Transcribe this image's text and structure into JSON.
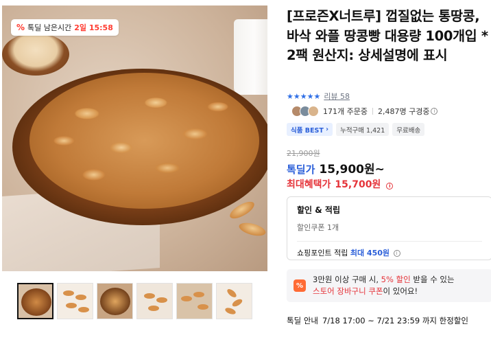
{
  "product_image": {
    "timer": {
      "label": "톡딜 남은시간",
      "value": "2일 15:58"
    }
  },
  "thumbnails": [
    {
      "name": "thumb-1"
    },
    {
      "name": "thumb-2"
    },
    {
      "name": "thumb-3"
    },
    {
      "name": "thumb-4"
    },
    {
      "name": "thumb-5"
    },
    {
      "name": "thumb-6"
    }
  ],
  "product": {
    "title": "[프로즌X너트루] 껍질없는 통땅콩, 바삭 와플 땅콩빵 대용량 100개입 * 2팩 원산지: 상세설명에 표시",
    "rating": {
      "stars": "★★★★★",
      "stars_value": 5,
      "review_label": "리뷰 58"
    },
    "social": {
      "orders": "171개 주문중",
      "subscribers": "2,487명 구경중"
    },
    "badges": {
      "best": "식품 BEST",
      "cumulative": "누적구매 1,421",
      "shipping": "무료배송"
    },
    "price": {
      "original": "21,900원",
      "sale_label": "톡딜가",
      "sale_price": "15,900원~",
      "max_label": "최대혜택가",
      "max_price": "15,700원"
    },
    "benefits": {
      "title": "할인 & 적립",
      "coupon": "할인쿠폰 1개",
      "points_label": "쇼핑포인트 적립",
      "points_value": "최대 450원"
    },
    "promo": {
      "line1_prefix": "3만원 이상 구매 시, ",
      "line1_highlight": "5% 할인",
      "line1_suffix": " 받을 수 있는",
      "line2_highlight": "스토어 장바구니 쿠폰",
      "line2_suffix": "이 있어요!"
    },
    "deal": {
      "label": "톡딜 안내",
      "period": "7/18 17:00 ~ 7/21 23:59 까지 한정할인"
    }
  },
  "colors": {
    "accent_blue": "#2b5fd9",
    "accent_red": "#e5343a",
    "promo_orange": "#ff6b35"
  }
}
